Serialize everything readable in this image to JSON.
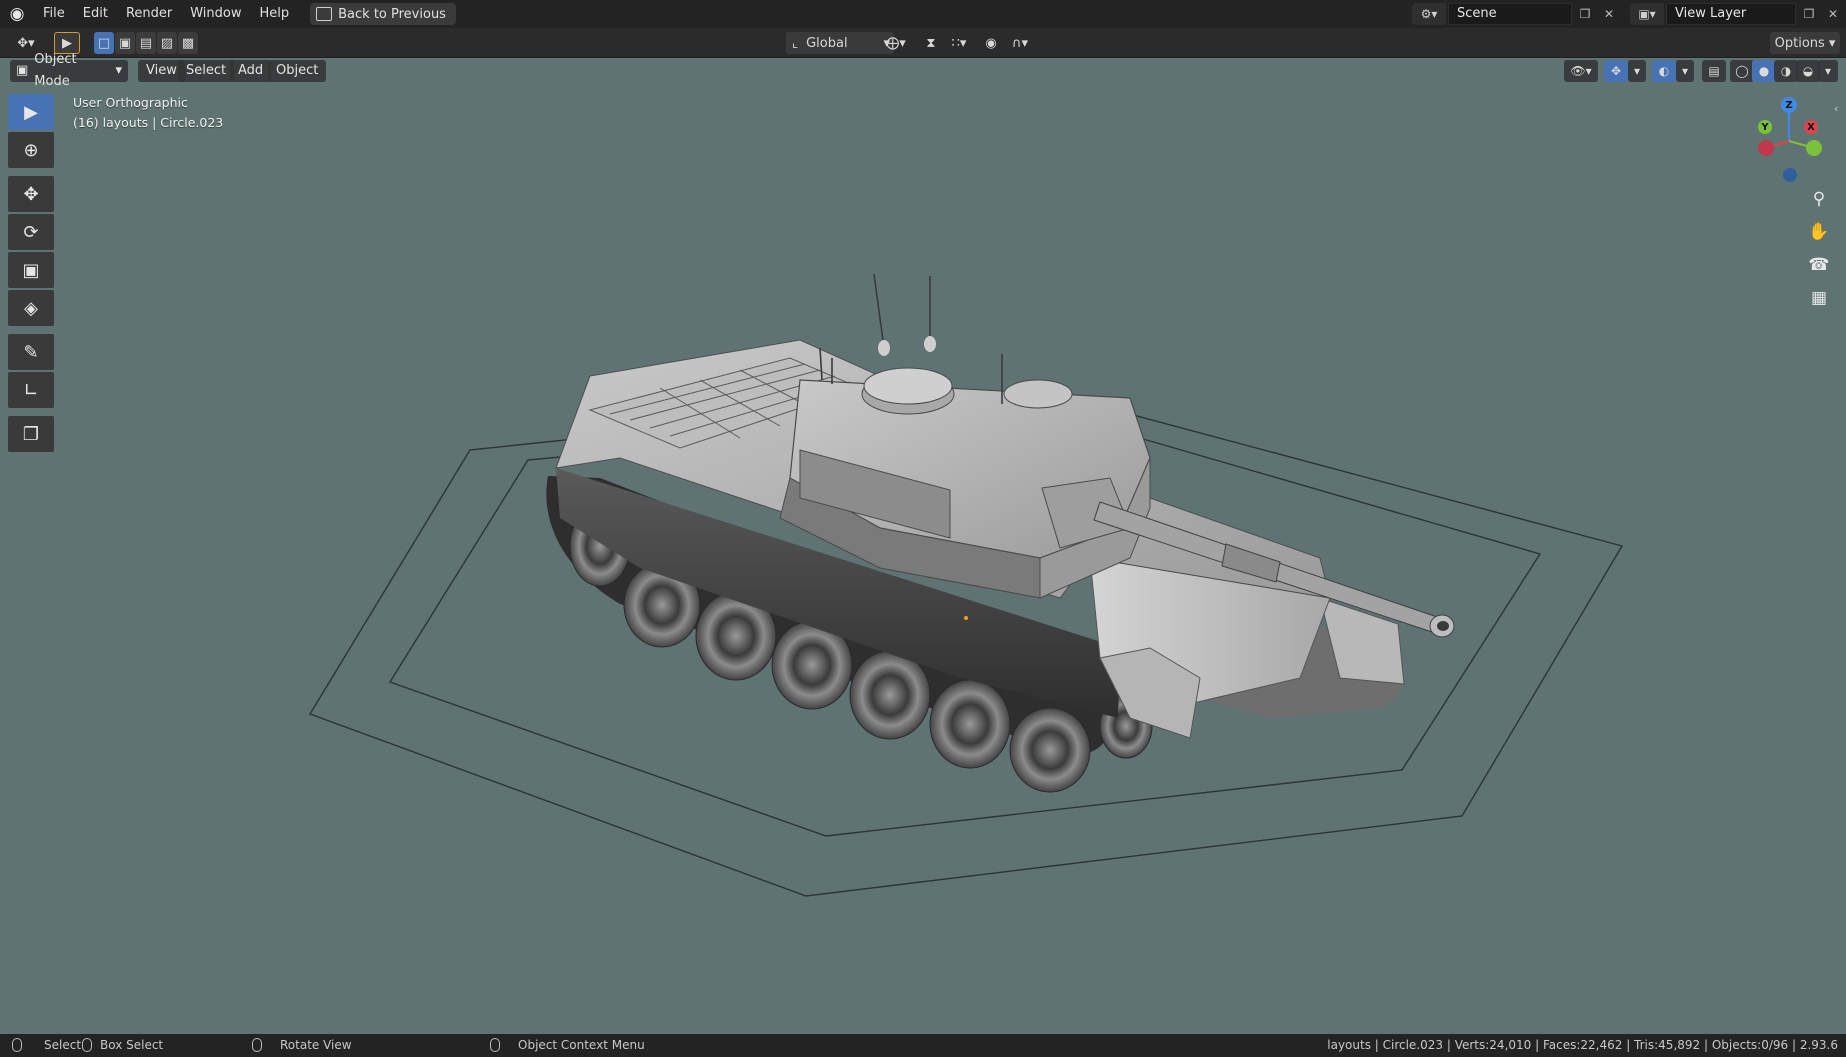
{
  "menubar": {
    "logo_icon": "blender-logo-icon",
    "items": [
      "File",
      "Edit",
      "Render",
      "Window",
      "Help"
    ],
    "back_button": "Back to Previous",
    "scene_name": "Scene",
    "view_layer_name": "View Layer"
  },
  "toolrow": {
    "transform_orientation": "Global",
    "options_label": "Options"
  },
  "viewport_header": {
    "mode": "Object Mode",
    "menus": [
      "View",
      "Select",
      "Add",
      "Object"
    ]
  },
  "viewport": {
    "view_name": "User Orthographic",
    "collection_info": "(16) layouts | Circle.023",
    "background_color": "#5f7373",
    "gizmo": {
      "x_label": "X",
      "y_label": "Y",
      "z_label": "Z",
      "x_color": "#e0434f",
      "y_color": "#7cc13a",
      "z_color": "#3f8ae6"
    }
  },
  "toolbar": {
    "tools": [
      "select-box-icon",
      "cursor-icon",
      "move-icon",
      "rotate-icon",
      "scale-icon",
      "transform-icon",
      "annotate-icon",
      "measure-icon",
      "add-cube-icon"
    ]
  },
  "statusbar": {
    "select": "Select",
    "box_select": "Box Select",
    "rotate_view": "Rotate View",
    "context_menu": "Object Context Menu",
    "stats": "layouts | Circle.023 | Verts:24,010 | Faces:22,462 | Tris:45,892 | Objects:0/96 | 2.93.6"
  },
  "accent_color": "#4772b3"
}
